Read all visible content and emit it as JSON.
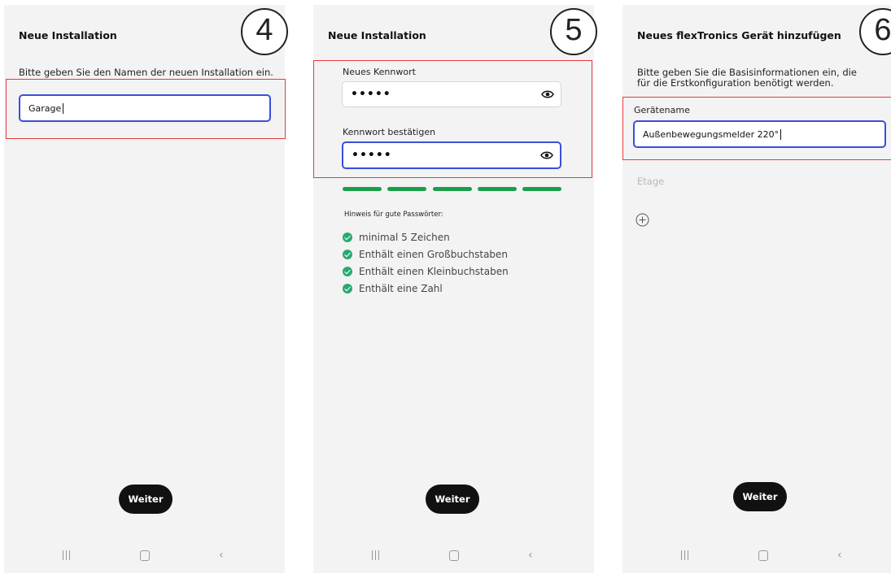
{
  "screens": [
    {
      "step": "4",
      "title": "Neue Installation",
      "description": "Bitte geben Sie den Namen der neuen Installation ein.",
      "name_field": {
        "value": "Garage"
      },
      "button": "Weiter"
    },
    {
      "step": "5",
      "title": "Neue Installation",
      "password": {
        "label": "Neues Kennwort",
        "value": "•••••"
      },
      "confirm": {
        "label": "Kennwort bestätigen",
        "value": "•••••"
      },
      "strength_segments_filled": 5,
      "hint_title": "Hinweis für gute Passwörter:",
      "criteria": [
        "minimal 5 Zeichen",
        "Enthält einen Großbuchstaben",
        "Enthält einen Kleinbuchstaben",
        "Enthält eine Zahl"
      ],
      "button": "Weiter"
    },
    {
      "step": "6",
      "title": "Neues flexTronics Gerät hinzufügen",
      "description_line1": "Bitte geben Sie  die Basisinformationen ein, die",
      "description_line2": "für die Erstkonfiguration benötigt werden.",
      "device_name": {
        "label": "Gerätename",
        "value": "Außenbewegungsmelder 220°"
      },
      "floor_label": "Etage",
      "button": "Weiter"
    }
  ],
  "colors": {
    "accent_border": "#3a4fd8",
    "highlight_box": "#e53b3b",
    "strength_bar": "#1a9e4a",
    "check": "#2ba874",
    "button_bg": "#111111"
  },
  "icons": [
    "eye-icon",
    "check-circle-icon",
    "plus-circle-icon",
    "recent-apps-icon",
    "home-icon",
    "back-icon"
  ]
}
